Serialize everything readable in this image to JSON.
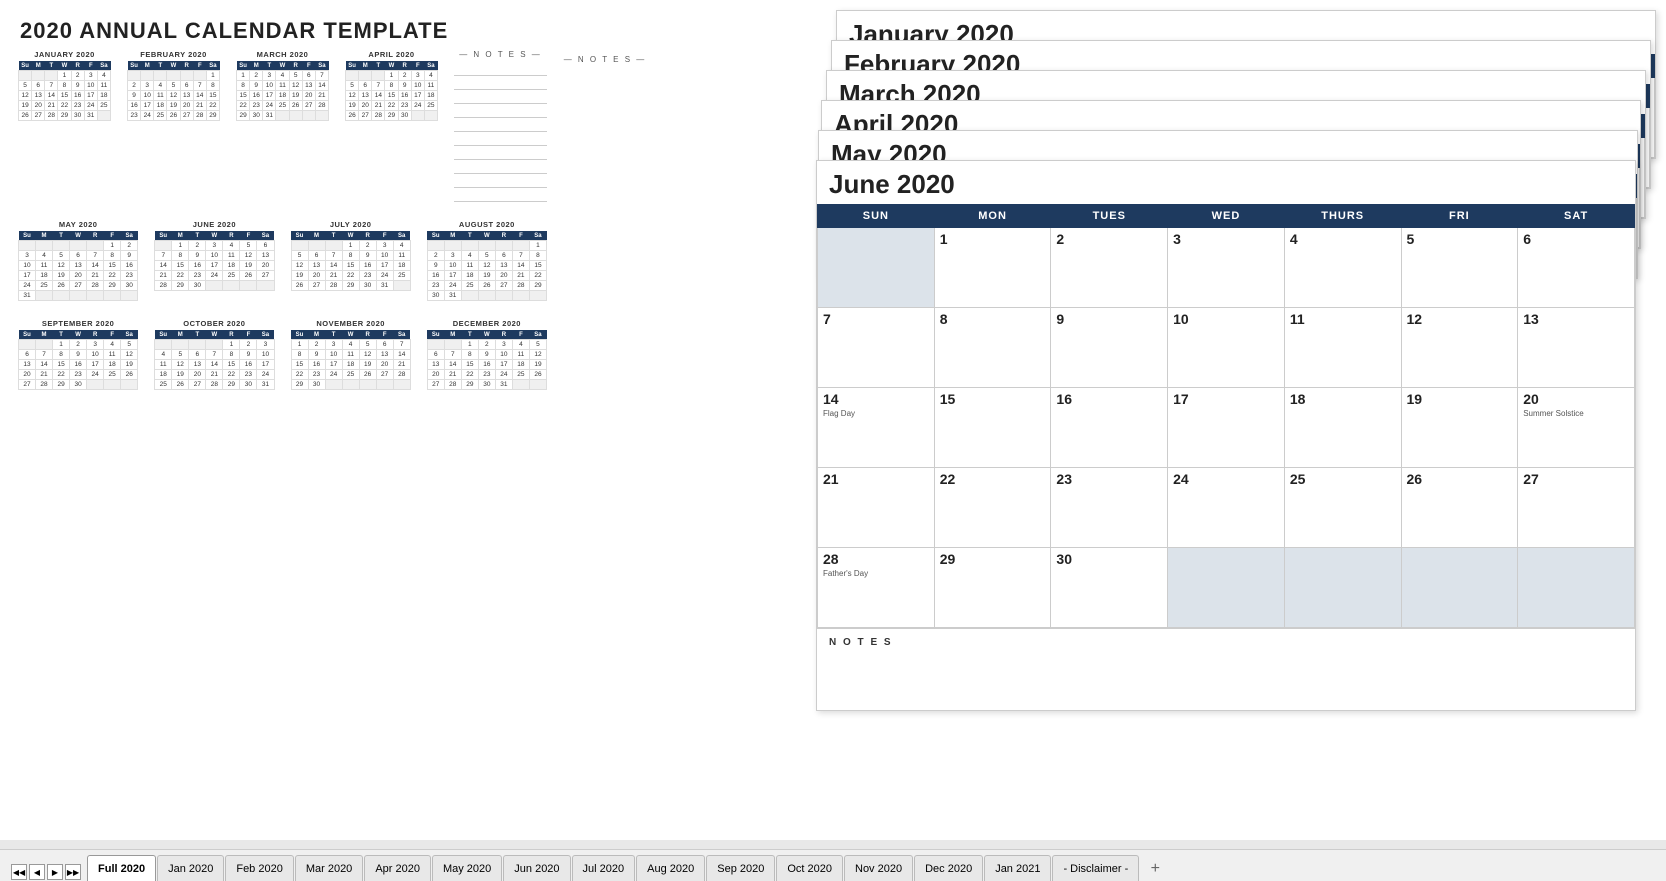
{
  "title": "2020 ANNUAL CALENDAR TEMPLATE",
  "months_mini": [
    {
      "name": "JANUARY 2020",
      "headers": [
        "Su",
        "M",
        "T",
        "W",
        "R",
        "F",
        "Sa"
      ],
      "weeks": [
        [
          "",
          "",
          "",
          "1",
          "2",
          "3",
          "4"
        ],
        [
          "5",
          "6",
          "7",
          "8",
          "9",
          "10",
          "11"
        ],
        [
          "12",
          "13",
          "14",
          "15",
          "16",
          "17",
          "18"
        ],
        [
          "19",
          "20",
          "21",
          "22",
          "23",
          "24",
          "25"
        ],
        [
          "26",
          "27",
          "28",
          "29",
          "30",
          "31",
          ""
        ]
      ]
    },
    {
      "name": "FEBRUARY 2020",
      "headers": [
        "Su",
        "M",
        "T",
        "W",
        "R",
        "F",
        "Sa"
      ],
      "weeks": [
        [
          "",
          "",
          "",
          "",
          "",
          "",
          "1"
        ],
        [
          "2",
          "3",
          "4",
          "5",
          "6",
          "7",
          "8"
        ],
        [
          "9",
          "10",
          "11",
          "12",
          "13",
          "14",
          "15"
        ],
        [
          "16",
          "17",
          "18",
          "19",
          "20",
          "21",
          "22"
        ],
        [
          "23",
          "24",
          "25",
          "26",
          "27",
          "28",
          "29"
        ]
      ]
    },
    {
      "name": "MARCH 2020",
      "headers": [
        "Su",
        "M",
        "T",
        "W",
        "R",
        "F",
        "Sa"
      ],
      "weeks": [
        [
          "1",
          "2",
          "3",
          "4",
          "5",
          "6",
          "7"
        ],
        [
          "8",
          "9",
          "10",
          "11",
          "12",
          "13",
          "14"
        ],
        [
          "15",
          "16",
          "17",
          "18",
          "19",
          "20",
          "21"
        ],
        [
          "22",
          "23",
          "24",
          "25",
          "26",
          "27",
          "28"
        ],
        [
          "29",
          "30",
          "31",
          "",
          "",
          "",
          ""
        ]
      ]
    },
    {
      "name": "APRIL 2020",
      "headers": [
        "Su",
        "M",
        "T",
        "W",
        "R",
        "F",
        "Sa"
      ],
      "weeks": [
        [
          "",
          "",
          "",
          "1",
          "2",
          "3",
          "4"
        ],
        [
          "5",
          "6",
          "7",
          "8",
          "9",
          "10",
          "11"
        ],
        [
          "12",
          "13",
          "14",
          "15",
          "16",
          "17",
          "18"
        ],
        [
          "19",
          "20",
          "21",
          "22",
          "23",
          "24",
          "25"
        ],
        [
          "26",
          "27",
          "28",
          "29",
          "30",
          "",
          ""
        ]
      ]
    },
    {
      "name": "MAY 2020",
      "headers": [
        "Su",
        "M",
        "T",
        "W",
        "R",
        "F",
        "Sa"
      ],
      "weeks": [
        [
          "",
          "",
          "",
          "",
          "",
          "1",
          "2"
        ],
        [
          "3",
          "4",
          "5",
          "6",
          "7",
          "8",
          "9"
        ],
        [
          "10",
          "11",
          "12",
          "13",
          "14",
          "15",
          "16"
        ],
        [
          "17",
          "18",
          "19",
          "20",
          "21",
          "22",
          "23"
        ],
        [
          "24",
          "25",
          "26",
          "27",
          "28",
          "29",
          "30"
        ],
        [
          "31",
          "",
          "",
          "",
          "",
          "",
          ""
        ]
      ]
    },
    {
      "name": "JUNE 2020",
      "headers": [
        "Su",
        "M",
        "T",
        "W",
        "R",
        "F",
        "Sa"
      ],
      "weeks": [
        [
          "",
          "1",
          "2",
          "3",
          "4",
          "5",
          "6"
        ],
        [
          "7",
          "8",
          "9",
          "10",
          "11",
          "12",
          "13"
        ],
        [
          "14",
          "15",
          "16",
          "17",
          "18",
          "19",
          "20"
        ],
        [
          "21",
          "22",
          "23",
          "24",
          "25",
          "26",
          "27"
        ],
        [
          "28",
          "29",
          "30",
          "",
          "",
          "",
          ""
        ]
      ]
    },
    {
      "name": "JULY 2020",
      "headers": [
        "Su",
        "M",
        "T",
        "W",
        "R",
        "F",
        "Sa"
      ],
      "weeks": [
        [
          "",
          "",
          "",
          "1",
          "2",
          "3",
          "4"
        ],
        [
          "5",
          "6",
          "7",
          "8",
          "9",
          "10",
          "11"
        ],
        [
          "12",
          "13",
          "14",
          "15",
          "16",
          "17",
          "18"
        ],
        [
          "19",
          "20",
          "21",
          "22",
          "23",
          "24",
          "25"
        ],
        [
          "26",
          "27",
          "28",
          "29",
          "30",
          "31",
          ""
        ]
      ]
    },
    {
      "name": "AUGUST 2020",
      "headers": [
        "Su",
        "M",
        "T",
        "W",
        "R",
        "F",
        "Sa"
      ],
      "weeks": [
        [
          "",
          "",
          "",
          "",
          "",
          "",
          "1"
        ],
        [
          "2",
          "3",
          "4",
          "5",
          "6",
          "7",
          "8"
        ],
        [
          "9",
          "10",
          "11",
          "12",
          "13",
          "14",
          "15"
        ],
        [
          "16",
          "17",
          "18",
          "19",
          "20",
          "21",
          "22"
        ],
        [
          "23",
          "24",
          "25",
          "26",
          "27",
          "28",
          "29"
        ],
        [
          "30",
          "31",
          "",
          "",
          "",
          "",
          ""
        ]
      ]
    },
    {
      "name": "SEPTEMBER 2020",
      "headers": [
        "Su",
        "M",
        "T",
        "W",
        "R",
        "F",
        "Sa"
      ],
      "weeks": [
        [
          "",
          "",
          "1",
          "2",
          "3",
          "4",
          "5"
        ],
        [
          "6",
          "7",
          "8",
          "9",
          "10",
          "11",
          "12"
        ],
        [
          "13",
          "14",
          "15",
          "16",
          "17",
          "18",
          "19"
        ],
        [
          "20",
          "21",
          "22",
          "23",
          "24",
          "25",
          "26"
        ],
        [
          "27",
          "28",
          "29",
          "30",
          "",
          "",
          ""
        ]
      ]
    },
    {
      "name": "OCTOBER 2020",
      "headers": [
        "Su",
        "M",
        "T",
        "W",
        "R",
        "F",
        "Sa"
      ],
      "weeks": [
        [
          "",
          "",
          "",
          "",
          "1",
          "2",
          "3"
        ],
        [
          "4",
          "5",
          "6",
          "7",
          "8",
          "9",
          "10"
        ],
        [
          "11",
          "12",
          "13",
          "14",
          "15",
          "16",
          "17"
        ],
        [
          "18",
          "19",
          "20",
          "21",
          "22",
          "23",
          "24"
        ],
        [
          "25",
          "26",
          "27",
          "28",
          "29",
          "30",
          "31"
        ]
      ]
    },
    {
      "name": "NOVEMBER 2020",
      "headers": [
        "Su",
        "M",
        "T",
        "W",
        "R",
        "F",
        "Sa"
      ],
      "weeks": [
        [
          "1",
          "2",
          "3",
          "4",
          "5",
          "6",
          "7"
        ],
        [
          "8",
          "9",
          "10",
          "11",
          "12",
          "13",
          "14"
        ],
        [
          "15",
          "16",
          "17",
          "18",
          "19",
          "20",
          "21"
        ],
        [
          "22",
          "23",
          "24",
          "25",
          "26",
          "27",
          "28"
        ],
        [
          "29",
          "30",
          "",
          "",
          "",
          "",
          ""
        ]
      ]
    },
    {
      "name": "DECEMBER 2020",
      "headers": [
        "Su",
        "M",
        "T",
        "W",
        "R",
        "F",
        "Sa"
      ],
      "weeks": [
        [
          "",
          "",
          "1",
          "2",
          "3",
          "4",
          "5"
        ],
        [
          "6",
          "7",
          "8",
          "9",
          "10",
          "11",
          "12"
        ],
        [
          "13",
          "14",
          "15",
          "16",
          "17",
          "18",
          "19"
        ],
        [
          "20",
          "21",
          "22",
          "23",
          "24",
          "25",
          "26"
        ],
        [
          "27",
          "28",
          "29",
          "30",
          "31",
          "",
          ""
        ]
      ]
    }
  ],
  "notes_label": "— N O T E S —",
  "monthly_cards": [
    {
      "title": "January 2020"
    },
    {
      "title": "February 2020"
    },
    {
      "title": "March 2020"
    },
    {
      "title": "April 2020"
    },
    {
      "title": "May 2020"
    },
    {
      "title": "June 2020"
    }
  ],
  "june_headers": [
    "SUN",
    "MON",
    "TUES",
    "WED",
    "THURS",
    "FRI",
    "SAT"
  ],
  "june_weeks": [
    [
      {
        "d": "",
        "gray": true
      },
      {
        "d": "1"
      },
      {
        "d": "2"
      },
      {
        "d": "3"
      },
      {
        "d": "4"
      },
      {
        "d": "5"
      },
      {
        "d": "6"
      }
    ],
    [
      {
        "d": "7"
      },
      {
        "d": "8"
      },
      {
        "d": "9"
      },
      {
        "d": "10"
      },
      {
        "d": "11"
      },
      {
        "d": "12"
      },
      {
        "d": "13"
      }
    ],
    [
      {
        "d": "14",
        "event": "Flag Day"
      },
      {
        "d": "15"
      },
      {
        "d": "16"
      },
      {
        "d": "17"
      },
      {
        "d": "18"
      },
      {
        "d": "19"
      },
      {
        "d": "20",
        "event": "Summer Solstice"
      }
    ],
    [
      {
        "d": "21"
      },
      {
        "d": "22"
      },
      {
        "d": "23"
      },
      {
        "d": "24"
      },
      {
        "d": "25"
      },
      {
        "d": "26"
      },
      {
        "d": "27"
      }
    ],
    [
      {
        "d": "28",
        "event": "Father's Day"
      },
      {
        "d": "29"
      },
      {
        "d": "30"
      },
      {
        "d": "",
        "gray": true
      },
      {
        "d": "",
        "gray": true
      },
      {
        "d": "",
        "gray": true
      },
      {
        "d": "",
        "gray": true
      }
    ]
  ],
  "june_notes_label": "N O T E S",
  "tabs": [
    {
      "label": "Full 2020",
      "active": true
    },
    {
      "label": "Jan 2020",
      "active": false
    },
    {
      "label": "Feb 2020",
      "active": false
    },
    {
      "label": "Mar 2020",
      "active": false
    },
    {
      "label": "Apr 2020",
      "active": false
    },
    {
      "label": "May 2020",
      "active": false
    },
    {
      "label": "Jun 2020",
      "active": false
    },
    {
      "label": "Jul 2020",
      "active": false
    },
    {
      "label": "Aug 2020",
      "active": false
    },
    {
      "label": "Sep 2020",
      "active": false
    },
    {
      "label": "Oct 2020",
      "active": false
    },
    {
      "label": "Nov 2020",
      "active": false
    },
    {
      "label": "Dec 2020",
      "active": false
    },
    {
      "label": "Jan 2021",
      "active": false
    },
    {
      "label": "- Disclaimer -",
      "active": false
    }
  ]
}
